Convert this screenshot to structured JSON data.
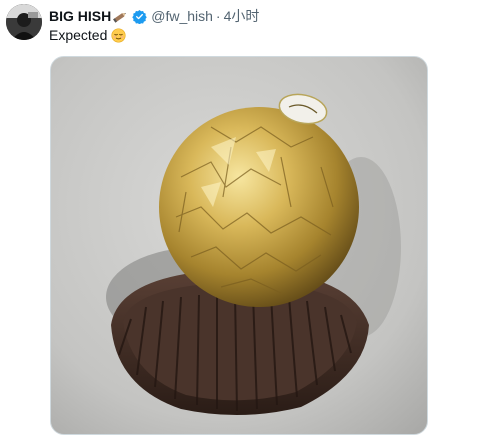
{
  "author": {
    "display_name": "BIG HISH",
    "handle": "@fw_hish",
    "separator": "·",
    "timestamp": "4小时",
    "verified": true
  },
  "tweet": {
    "text": "Expected",
    "emoji": "relieved-face-emoji"
  },
  "media": {
    "description_icon": "ferrero-rocher-photo"
  },
  "colors": {
    "verified_blue": "#1d9bf0",
    "handle_gray": "#536471",
    "text": "#0f1419"
  }
}
